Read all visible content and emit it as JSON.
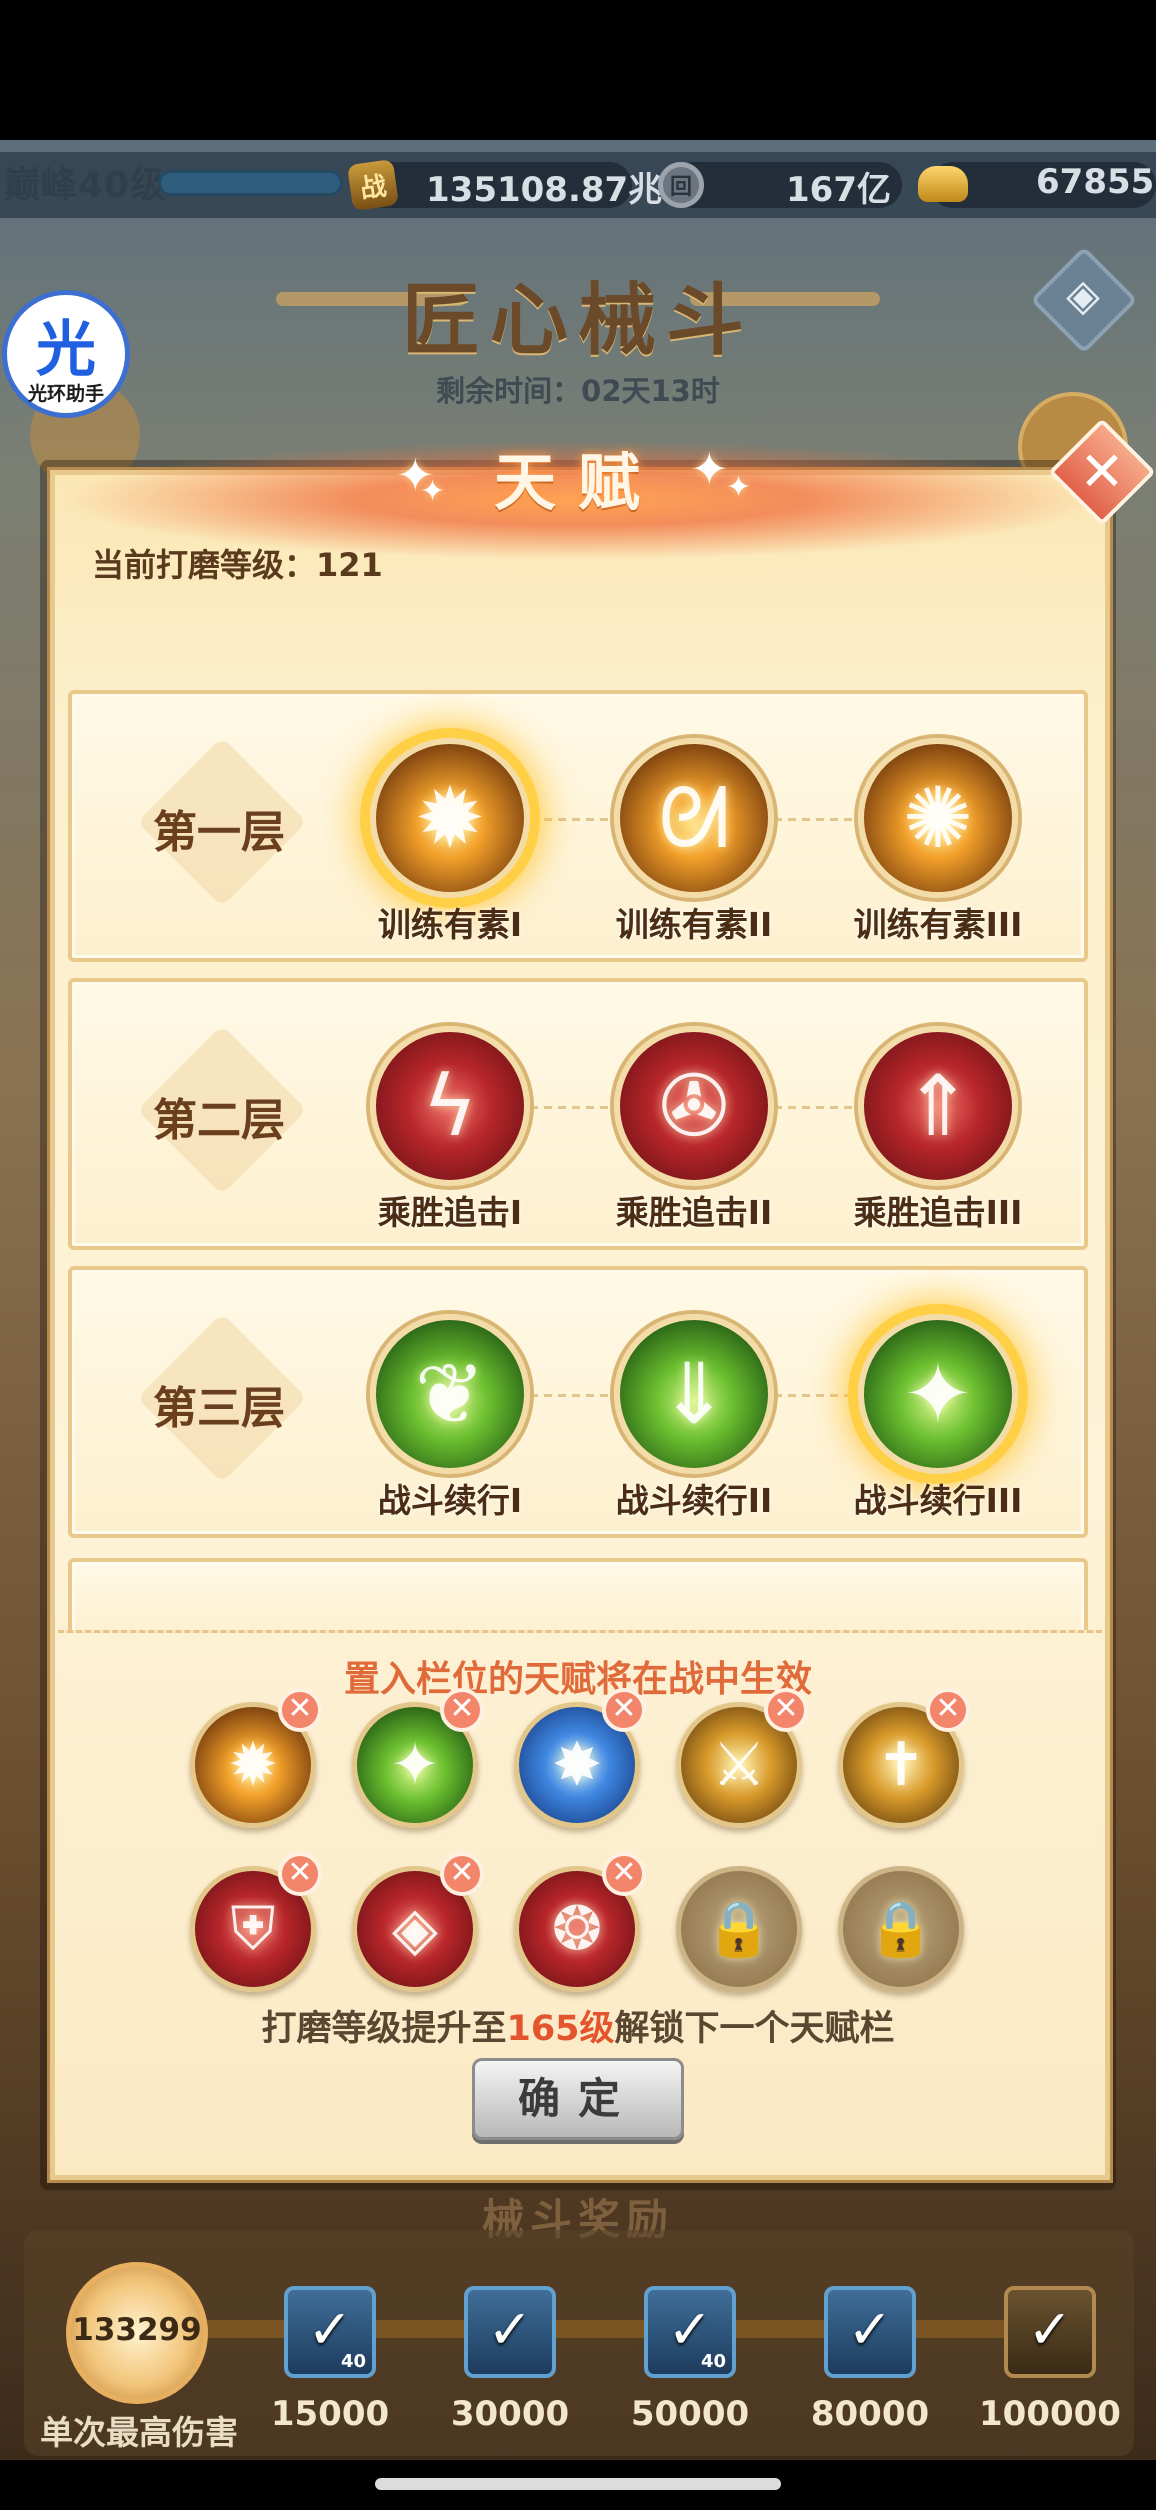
{
  "topbar": {
    "level": "巅峰40级",
    "combat_icon": "战",
    "combat_power": "135108.87兆",
    "coin_icon": "回",
    "coins": "167亿",
    "gold": "67855"
  },
  "event": {
    "title": "匠心械斗",
    "remaining": "剩余时间：02天13时",
    "side_diamond_glyph": "◈"
  },
  "helper": {
    "glyph": "光",
    "label": "光环助手"
  },
  "modal": {
    "title": "天赋",
    "close_glyph": "✕",
    "current_level": "当前打磨等级：121",
    "tiers": [
      {
        "label": "第一层",
        "talents": [
          {
            "name": "训练有素I",
            "icon": "fire-claw-icon",
            "color": "fire",
            "selected": true
          },
          {
            "name": "训练有素II",
            "icon": "fire-swirl-icon",
            "color": "fire",
            "selected": false
          },
          {
            "name": "训练有素III",
            "icon": "fire-burst-icon",
            "color": "fire",
            "selected": false
          }
        ]
      },
      {
        "label": "第二层",
        "talents": [
          {
            "name": "乘胜追击I",
            "icon": "lightning-icon",
            "color": "red",
            "selected": false
          },
          {
            "name": "乘胜追击II",
            "icon": "vortex-icon",
            "color": "red",
            "selected": false
          },
          {
            "name": "乘胜追击III",
            "icon": "arrow-up-icon",
            "color": "red",
            "selected": false
          }
        ]
      },
      {
        "label": "第三层",
        "talents": [
          {
            "name": "战斗续行I",
            "icon": "green-flame-icon",
            "color": "green",
            "selected": false
          },
          {
            "name": "战斗续行II",
            "icon": "green-arrow-icon",
            "color": "green",
            "selected": false
          },
          {
            "name": "战斗续行III",
            "icon": "green-slash-icon",
            "color": "green",
            "selected": true
          }
        ]
      }
    ],
    "slot_hint": "置入栏位的天赋将在战中生效",
    "remove_glyph": "✕",
    "lock_glyph": "🔒",
    "slots_row1": [
      {
        "icon": "fire-claw-icon",
        "color": "fire",
        "glyph": "✹"
      },
      {
        "icon": "green-slash-icon",
        "color": "green",
        "glyph": "✦"
      },
      {
        "icon": "blue-burst-icon",
        "color": "blue",
        "glyph": "✸"
      },
      {
        "icon": "sword-swirl-icon",
        "color": "gold",
        "glyph": "⚔"
      },
      {
        "icon": "sword-down-icon",
        "color": "gold",
        "glyph": "✝"
      }
    ],
    "slots_row2": [
      {
        "icon": "red-shield-icon",
        "color": "red",
        "glyph": "⛨",
        "locked": false
      },
      {
        "icon": "shield-swirl-icon",
        "color": "red",
        "glyph": "◈",
        "locked": false
      },
      {
        "icon": "flame-shield-icon",
        "color": "red",
        "glyph": "❂",
        "locked": false
      },
      {
        "icon": "lock-icon",
        "color": "locked",
        "locked": true
      },
      {
        "icon": "lock-icon",
        "color": "locked",
        "locked": true
      }
    ],
    "unlock_pre": "打磨等级提升至",
    "unlock_level": "165级",
    "unlock_post": "解锁下一个天赋栏",
    "confirm": "确定"
  },
  "rewards": {
    "title": "械斗奖励",
    "damage_value": "133299",
    "damage_label": "单次最高伤害",
    "check_glyph": "✓",
    "milestones": [
      {
        "value": "15000",
        "count": "40"
      },
      {
        "value": "30000",
        "count": ""
      },
      {
        "value": "50000",
        "count": "40"
      },
      {
        "value": "80000",
        "count": ""
      },
      {
        "value": "100000",
        "count": ""
      }
    ]
  },
  "colors": {
    "accent_orange": "#e06a3a",
    "unlock_red": "#e2552e",
    "modal_bg": "#fdf3d8",
    "gold_glow": "#ffcf45"
  }
}
